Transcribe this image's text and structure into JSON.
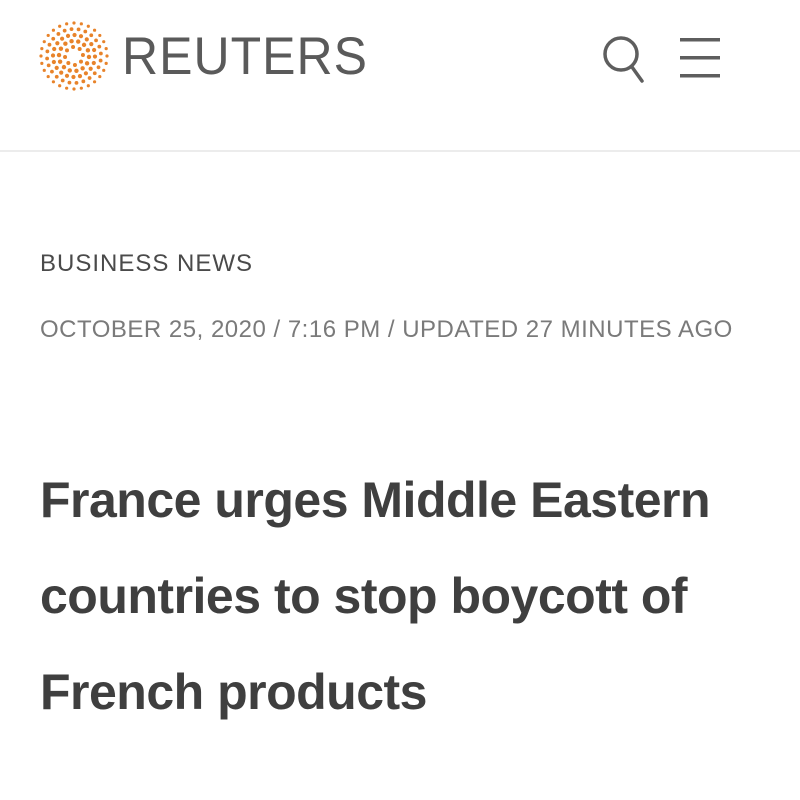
{
  "header": {
    "brand": "REUTERS",
    "logo_icon": "reuters-dot-sphere-logo",
    "search_icon": "search-icon",
    "menu_icon": "hamburger-menu-icon",
    "accent_color": "#e8832a"
  },
  "article": {
    "section": "BUSINESS NEWS",
    "dateline": "OCTOBER 25, 2020 / 7:16 PM / UPDATED 27 MINUTES AGO",
    "headline": "France urges Middle Eastern countries to stop boycott of French products"
  }
}
